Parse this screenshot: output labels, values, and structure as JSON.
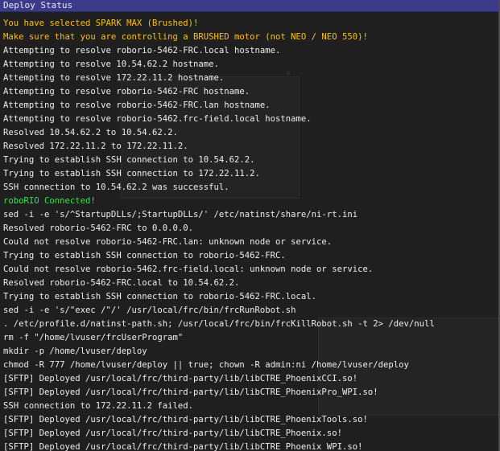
{
  "window": {
    "title": "Deploy Status"
  },
  "colors": {
    "background": "#1f1f1f",
    "titlebar": "#3b3b8a",
    "text": "#eeeeee",
    "warning": "#ffc100",
    "success": "#2ee84a"
  },
  "log": [
    {
      "text": "You have selected SPARK MAX (Brushed)!",
      "kind": "warning"
    },
    {
      "text": "Make sure that you are controlling a BRUSHED motor (not NEO / NEO 550)!",
      "kind": "warning"
    },
    {
      "text": "Attempting to resolve roborio-5462-FRC.local hostname.",
      "kind": "normal"
    },
    {
      "text": "Attempting to resolve 10.54.62.2 hostname.",
      "kind": "normal"
    },
    {
      "text": "Attempting to resolve 172.22.11.2 hostname.",
      "kind": "normal"
    },
    {
      "text": "Attempting to resolve roborio-5462-FRC hostname.",
      "kind": "normal"
    },
    {
      "text": "Attempting to resolve roborio-5462-FRC.lan hostname.",
      "kind": "normal"
    },
    {
      "text": "Attempting to resolve roborio-5462.frc-field.local hostname.",
      "kind": "normal"
    },
    {
      "text": "Resolved 10.54.62.2 to 10.54.62.2.",
      "kind": "normal"
    },
    {
      "text": "Resolved 172.22.11.2 to 172.22.11.2.",
      "kind": "normal"
    },
    {
      "text": "Trying to establish SSH connection to 10.54.62.2.",
      "kind": "normal"
    },
    {
      "text": "Trying to establish SSH connection to 172.22.11.2.",
      "kind": "normal"
    },
    {
      "text": "SSH connection to 10.54.62.2 was successful.",
      "kind": "normal"
    },
    {
      "text": "roboRIO Connected!",
      "kind": "success"
    },
    {
      "text": "sed -i -e 's/^StartupDLLs/;StartupDLLs/' /etc/natinst/share/ni-rt.ini",
      "kind": "normal"
    },
    {
      "text": "Resolved roborio-5462-FRC to 0.0.0.0.",
      "kind": "normal"
    },
    {
      "text": "Could not resolve roborio-5462-FRC.lan: unknown node or service.",
      "kind": "normal"
    },
    {
      "text": "Trying to establish SSH connection to roborio-5462-FRC.",
      "kind": "normal"
    },
    {
      "text": "Could not resolve roborio-5462.frc-field.local: unknown node or service.",
      "kind": "normal"
    },
    {
      "text": "Resolved roborio-5462-FRC.local to 10.54.62.2.",
      "kind": "normal"
    },
    {
      "text": "Trying to establish SSH connection to roborio-5462-FRC.local.",
      "kind": "normal"
    },
    {
      "text": "sed -i -e 's/\"exec /\"/' /usr/local/frc/bin/frcRunRobot.sh",
      "kind": "normal"
    },
    {
      "text": ". /etc/profile.d/natinst-path.sh; /usr/local/frc/bin/frcKillRobot.sh -t 2> /dev/null",
      "kind": "normal"
    },
    {
      "text": "rm -f \"/home/lvuser/frcUserProgram\"",
      "kind": "normal"
    },
    {
      "text": "mkdir -p /home/lvuser/deploy",
      "kind": "normal"
    },
    {
      "text": "chmod -R 777 /home/lvuser/deploy || true; chown -R admin:ni /home/lvuser/deploy",
      "kind": "normal"
    },
    {
      "text": "[SFTP] Deployed /usr/local/frc/third-party/lib/libCTRE_PhoenixCCI.so!",
      "kind": "normal"
    },
    {
      "text": "[SFTP] Deployed /usr/local/frc/third-party/lib/libCTRE_PhoenixPro_WPI.so!",
      "kind": "normal"
    },
    {
      "text": "SSH connection to 172.22.11.2 failed.",
      "kind": "normal"
    },
    {
      "text": "[SFTP] Deployed /usr/local/frc/third-party/lib/libCTRE_PhoenixTools.so!",
      "kind": "normal"
    },
    {
      "text": "[SFTP] Deployed /usr/local/frc/third-party/lib/libCTRE_Phoenix.so!",
      "kind": "normal"
    },
    {
      "text": "[SFTP] Deployed /usr/local/frc/third-party/lib/libCTRE_Phoenix_WPI.so!",
      "kind": "normal"
    }
  ]
}
